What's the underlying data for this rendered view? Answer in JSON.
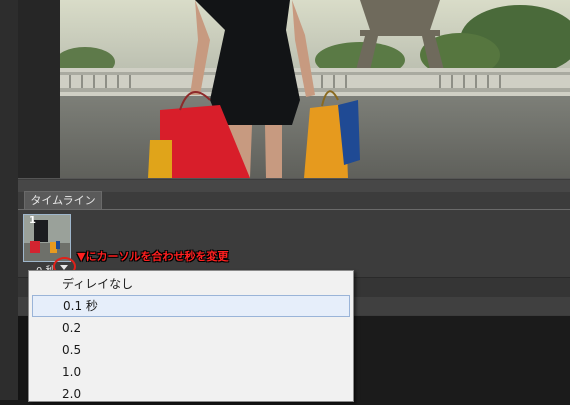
{
  "timeline": {
    "tab_label": "タイムライン",
    "frame": {
      "number": "1",
      "delay": "0 秒"
    }
  },
  "annotation": "▼にカーソルを合わせ秒を変更",
  "delay_menu": {
    "items": [
      "ディレイなし",
      "0.1 秒",
      "0.2",
      "0.5",
      "1.0",
      "2.0"
    ],
    "highlighted": "0.1 秒"
  },
  "colors": {
    "annotation_red": "#ff2020",
    "panel": "#3c3c3c",
    "menu_bg": "#f1f1f1",
    "menu_highlight": "#e6eefa"
  }
}
